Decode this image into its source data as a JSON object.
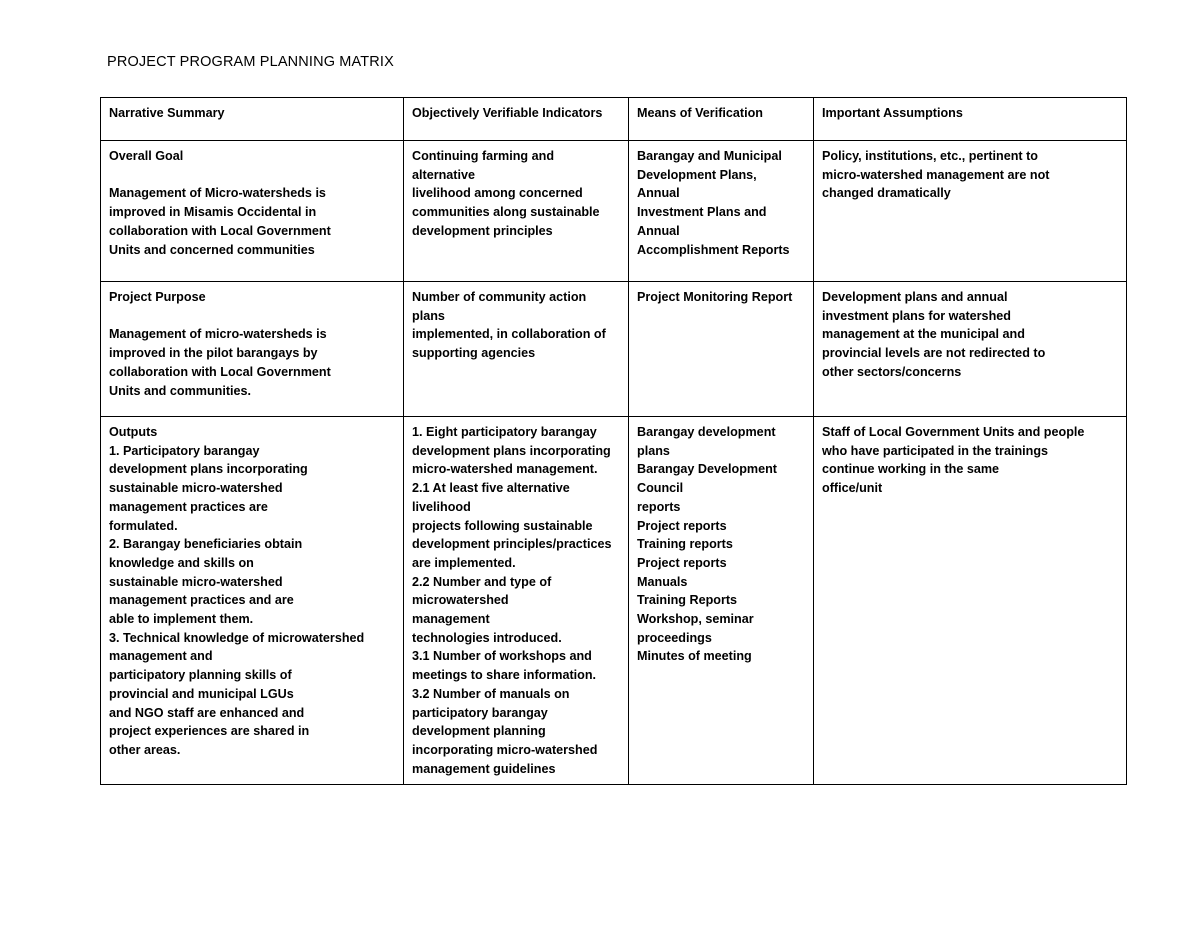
{
  "document": {
    "title": "PROJECT PROGRAM PLANNING MATRIX"
  },
  "matrix": {
    "headers": [
      "Narrative Summary",
      "Objectively Verifiable Indicators",
      "Means of Verification",
      "Important Assumptions"
    ],
    "rows": [
      {
        "name": "overall-goal",
        "narrative_summary": [
          "Overall Goal",
          "",
          "Management of Micro-watersheds is",
          "improved in Misamis Occidental in",
          "collaboration with Local Government",
          "Units and concerned communities"
        ],
        "indicators": [
          "Continuing farming and",
          "alternative",
          "livelihood among concerned",
          "communities along sustainable",
          "development principles"
        ],
        "verification": [
          "Barangay and Municipal",
          "Development Plans,",
          "Annual",
          "Investment Plans and",
          "Annual",
          "Accomplishment Reports"
        ],
        "assumptions": [
          "Policy, institutions, etc., pertinent to",
          "micro-watershed management are not",
          "changed dramatically"
        ]
      },
      {
        "name": "project-purpose",
        "narrative_summary": [
          "Project Purpose",
          "",
          "Management of micro-watersheds is",
          "improved in the pilot barangays by",
          "collaboration with Local Government",
          "Units and communities."
        ],
        "indicators": [
          "Number of community action",
          "plans",
          "implemented, in collaboration of",
          "supporting agencies"
        ],
        "verification": [
          "Project Monitoring Report"
        ],
        "assumptions": [
          "Development plans and annual",
          "investment plans for watershed",
          "management at the municipal and",
          "provincial levels are not redirected to",
          "other sectors/concerns"
        ]
      },
      {
        "name": "outputs",
        "narrative_summary": [
          "Outputs",
          "1. Participatory barangay",
          "development plans incorporating",
          "sustainable micro-watershed",
          "management practices are",
          "formulated.",
          "2. Barangay beneficiaries obtain",
          "knowledge and skills on",
          "sustainable micro-watershed",
          "management practices and are",
          "able to implement them.",
          "3. Technical knowledge of microwatershed",
          "management and",
          "participatory planning skills of",
          "provincial and municipal LGUs",
          "and NGO staff are enhanced and",
          "project experiences are shared in",
          "other areas."
        ],
        "indicators": [
          "1. Eight participatory barangay",
          "development plans incorporating",
          "micro-watershed management.",
          "2.1 At least five alternative",
          "livelihood",
          "projects following sustainable",
          "development principles/practices",
          "are implemented.",
          "2.2 Number and type of",
          "microwatershed",
          "management",
          "technologies introduced.",
          "3.1 Number of workshops and",
          "meetings to share information.",
          "3.2 Number of manuals on",
          "participatory barangay",
          "development planning",
          "incorporating micro-watershed",
          "management guidelines"
        ],
        "verification": [
          "Barangay development",
          "plans",
          "Barangay Development",
          "Council",
          "reports",
          "Project reports",
          "Training reports",
          "Project reports",
          "Manuals",
          "Training Reports",
          "Workshop, seminar",
          "proceedings",
          "Minutes of meeting"
        ],
        "assumptions": [
          "Staff of Local Government Units and people",
          "who have participated in the trainings",
          "continue working in the same",
          "office/unit"
        ]
      }
    ]
  }
}
